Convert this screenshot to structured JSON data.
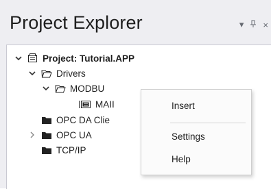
{
  "panel": {
    "title": "Project Explorer",
    "window_icons": [
      "chevron-down-icon",
      "pin-icon",
      "close-icon"
    ],
    "window_icon_glyphs": [
      "▾",
      "ᵖ",
      "×"
    ]
  },
  "tree": [
    {
      "label": "Project: Tutorial.APP",
      "expanded": true,
      "icon": "project-icon"
    },
    {
      "label": "Drivers",
      "expanded": true,
      "icon": "folder-open-icon"
    },
    {
      "label": "MODBU",
      "expanded": true,
      "icon": "folder-open-icon"
    },
    {
      "label": "MAII",
      "icon": "device-icon"
    },
    {
      "label": "OPC DA Clie",
      "icon": "folder-icon"
    },
    {
      "label": "OPC UA",
      "expanded": false,
      "icon": "folder-icon"
    },
    {
      "label": "TCP/IP",
      "icon": "folder-icon"
    }
  ],
  "context_menu": {
    "items": [
      "Insert",
      "Settings",
      "Help"
    ]
  }
}
